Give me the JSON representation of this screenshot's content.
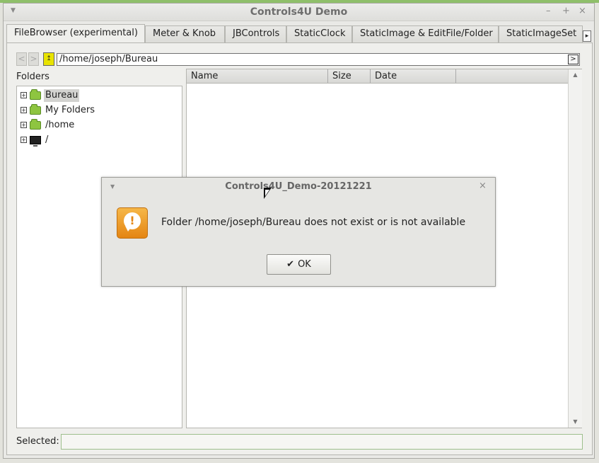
{
  "window": {
    "title": "Controls4U Demo",
    "menu_icon": "chevron-down-icon",
    "minimize": "–",
    "maximize": "+",
    "close": "×"
  },
  "tabs": [
    {
      "label": "FileBrowser (experimental)",
      "active": true
    },
    {
      "label": "Meter & Knob"
    },
    {
      "label": "JBControls"
    },
    {
      "label": "StaticClock"
    },
    {
      "label": "StaticImage & EditFile/Folder"
    },
    {
      "label": "StaticImageSet"
    }
  ],
  "tab_scroll": "▸",
  "toolbar": {
    "back": "<",
    "forward": ">",
    "up": "↥",
    "path": "/home/joseph/Bureau",
    "go": ">"
  },
  "folders": {
    "label": "Folders",
    "items": [
      {
        "label": "Bureau",
        "icon": "folder-icon",
        "selected": true
      },
      {
        "label": "My Folders",
        "icon": "folder-icon"
      },
      {
        "label": "/home",
        "icon": "folder-icon"
      },
      {
        "label": "/",
        "icon": "monitor-icon"
      }
    ]
  },
  "files": {
    "columns": [
      "Name",
      "Size",
      "Date"
    ],
    "rows": []
  },
  "footer": {
    "selected_label": "Selected:",
    "selected_value": ""
  },
  "dialog": {
    "title": "Controls4U_Demo-20121221",
    "message": "Folder /home/joseph/Bureau does not exist or is not available",
    "icon": "info-icon",
    "ok_label": "OK"
  },
  "colors": {
    "accent_green": "#8ec540",
    "dialog_icon": "#e48513"
  }
}
